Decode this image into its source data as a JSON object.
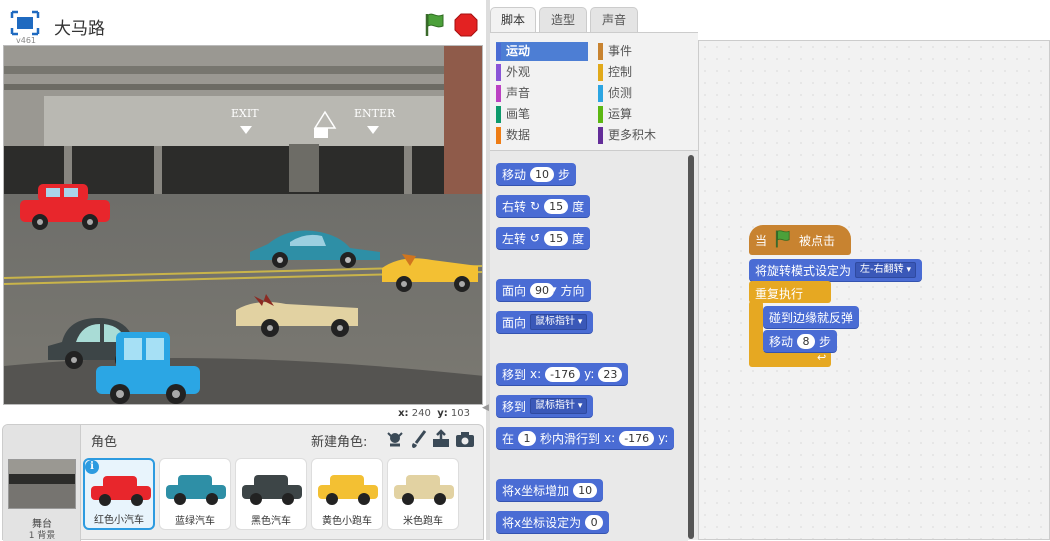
{
  "project": {
    "title": "大马路",
    "version": "v461"
  },
  "stage": {
    "coord_x_label": "x:",
    "coord_x": "240",
    "coord_y_label": "y:",
    "coord_y": "103",
    "sign_exit": "EXIT",
    "sign_enter": "ENTER"
  },
  "sprite_panel": {
    "stage_label": "舞台",
    "backdrop_count": "1 背景",
    "role_label": "角色",
    "new_role_label": "新建角色:",
    "sprites": [
      {
        "name": "红色小汽车",
        "color": "#e8262c",
        "selected": true
      },
      {
        "name": "蓝绿汽车",
        "color": "#2e8fa6",
        "selected": false
      },
      {
        "name": "黑色汽车",
        "color": "#3d4547",
        "selected": false
      },
      {
        "name": "黄色小跑车",
        "color": "#f3c033",
        "selected": false
      },
      {
        "name": "米色跑车",
        "color": "#e2d2a2",
        "selected": false
      }
    ],
    "info_icon": "i"
  },
  "tabs": [
    "脚本",
    "造型",
    "声音"
  ],
  "categories": [
    {
      "label": "运动",
      "color": "#4a6cd4",
      "selected": true
    },
    {
      "label": "事件",
      "color": "#c88330"
    },
    {
      "label": "外观",
      "color": "#8a55d7"
    },
    {
      "label": "控制",
      "color": "#e1a91a"
    },
    {
      "label": "声音",
      "color": "#bb42c3"
    },
    {
      "label": "侦测",
      "color": "#2ca5e2"
    },
    {
      "label": "画笔",
      "color": "#0e9a6c"
    },
    {
      "label": "运算",
      "color": "#5cb712"
    },
    {
      "label": "数据",
      "color": "#ee7d16"
    },
    {
      "label": "更多积木",
      "color": "#632d99"
    }
  ],
  "palette": {
    "move": {
      "a": "移动",
      "n": "10",
      "b": "步"
    },
    "turn_right": {
      "a": "右转",
      "n": "15",
      "b": "度"
    },
    "turn_left": {
      "a": "左转",
      "n": "15",
      "b": "度"
    },
    "point_dir": {
      "a": "面向",
      "n": "90",
      "b": "方向"
    },
    "point_towards": {
      "a": "面向",
      "dd": "鼠标指针"
    },
    "goto_xy": {
      "a": "移到",
      "x": "x:",
      "xv": "-176",
      "y": "y:",
      "yv": "23"
    },
    "goto": {
      "a": "移到",
      "dd": "鼠标指针"
    },
    "glide": {
      "a": "在",
      "n": "1",
      "b": "秒内滑行到",
      "x": "x:",
      "xv": "-176",
      "y": "y:"
    },
    "change_x": {
      "a": "将x坐标增加",
      "n": "10"
    },
    "set_x": {
      "a": "将x坐标设定为",
      "n": "0"
    }
  },
  "script": {
    "when_flag": {
      "a": "当",
      "b": "被点击"
    },
    "rotation": {
      "a": "将旋转模式设定为",
      "dd": "左-右翻转"
    },
    "forever": {
      "label": "重复执行"
    },
    "bounce": {
      "label": "碰到边缘就反弹"
    },
    "move": {
      "a": "移动",
      "n": "8",
      "b": "步"
    }
  }
}
